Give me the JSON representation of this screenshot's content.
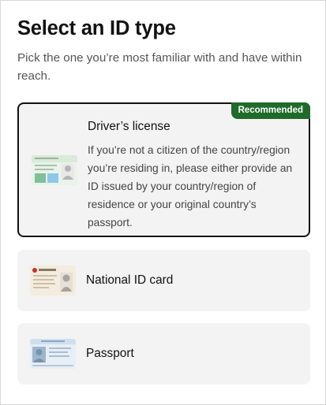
{
  "header": {
    "title": "Select an ID type",
    "subtitle": "Pick the one you’re most familiar with and have within reach."
  },
  "options": [
    {
      "label": "Driver’s license",
      "badge": "Recommended",
      "description": "If you’re not a citizen of the country/region you’re residing in, please either provide an ID issued by your country/region of residence or your original country’s passport.",
      "selected": true,
      "icon": "drivers-license-icon"
    },
    {
      "label": "National ID card",
      "selected": false,
      "icon": "national-id-card-icon"
    },
    {
      "label": "Passport",
      "selected": false,
      "icon": "passport-icon"
    }
  ],
  "colors": {
    "badge": "#1f6b2a",
    "card_bg": "#f3f3f3",
    "selected_border": "#111111"
  }
}
